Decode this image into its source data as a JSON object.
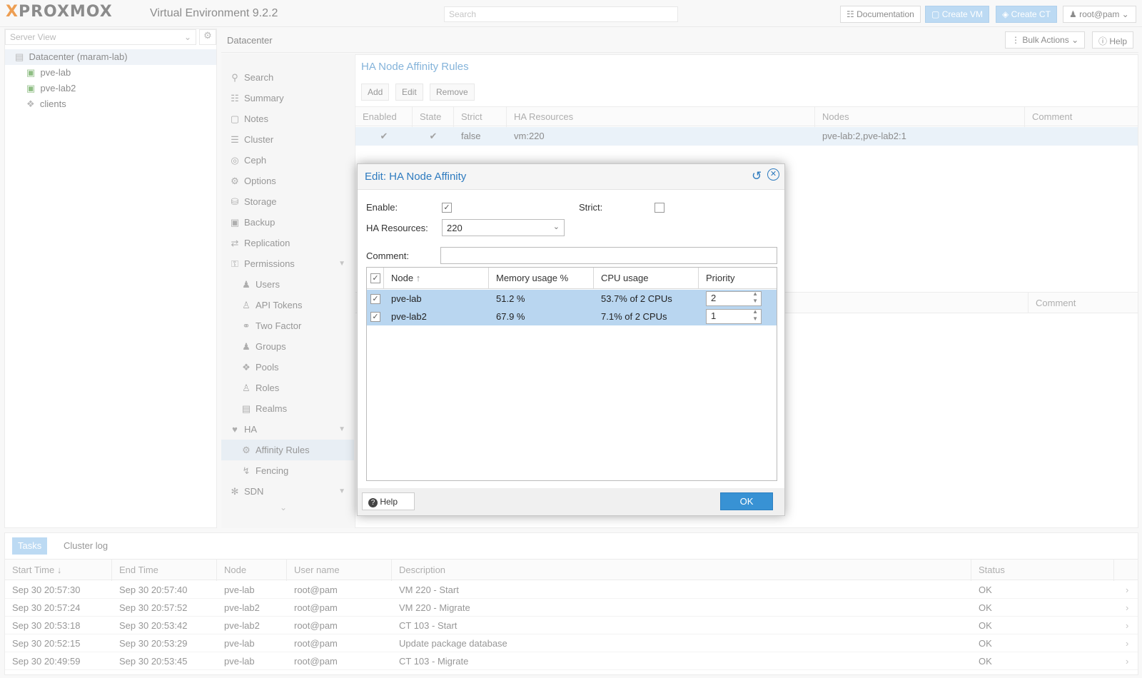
{
  "topbar": {
    "logo_x": "X",
    "logo_rest": "PROXMOX",
    "version": "Virtual Environment 9.2.2",
    "search_placeholder": "Search",
    "documentation": "Documentation",
    "create_vm": "Create VM",
    "create_ct": "Create CT",
    "user": "root@pam"
  },
  "tree": {
    "view": "Server View",
    "items": [
      {
        "label": "Datacenter (maram-lab)",
        "icon": "datacenter-icon"
      },
      {
        "label": "pve-lab",
        "icon": "node-online-icon"
      },
      {
        "label": "pve-lab2",
        "icon": "node-online-icon"
      },
      {
        "label": "clients",
        "icon": "tags-icon"
      }
    ]
  },
  "header": {
    "breadcrumb": "Datacenter",
    "bulk_actions": "Bulk Actions",
    "help": "Help"
  },
  "nav": {
    "items": [
      {
        "label": "Search",
        "icon": "search-icon"
      },
      {
        "label": "Summary",
        "icon": "book-icon"
      },
      {
        "label": "Notes",
        "icon": "notes-icon"
      },
      {
        "label": "Cluster",
        "icon": "server-icon"
      },
      {
        "label": "Ceph",
        "icon": "ceph-icon"
      },
      {
        "label": "Options",
        "icon": "gear-icon"
      },
      {
        "label": "Storage",
        "icon": "database-icon"
      },
      {
        "label": "Backup",
        "icon": "floppy-icon"
      },
      {
        "label": "Replication",
        "icon": "retweet-icon"
      },
      {
        "label": "Permissions",
        "icon": "unlock-icon"
      },
      {
        "label": "Users",
        "icon": "user-icon"
      },
      {
        "label": "API Tokens",
        "icon": "user-outline-icon"
      },
      {
        "label": "Two Factor",
        "icon": "key-icon"
      },
      {
        "label": "Groups",
        "icon": "users-icon"
      },
      {
        "label": "Pools",
        "icon": "tags-icon"
      },
      {
        "label": "Roles",
        "icon": "male-icon"
      },
      {
        "label": "Realms",
        "icon": "address-book-icon"
      },
      {
        "label": "HA",
        "icon": "heartbeat-icon"
      },
      {
        "label": "Affinity Rules",
        "icon": "gears-icon"
      },
      {
        "label": "Fencing",
        "icon": "bolt-icon"
      },
      {
        "label": "SDN",
        "icon": "sdn-icon"
      }
    ]
  },
  "panel": {
    "title": "HA Node Affinity Rules",
    "buttons": {
      "add": "Add",
      "edit": "Edit",
      "remove": "Remove"
    },
    "columns": [
      "Enabled",
      "State",
      "Strict",
      "HA Resources",
      "Nodes",
      "Comment"
    ],
    "row": {
      "enabled": "✔",
      "state": "✔",
      "strict": "false",
      "resources": "vm:220",
      "nodes": "pve-lab:2,pve-lab2:1",
      "comment": ""
    },
    "comment_col2": "Comment"
  },
  "dialog": {
    "title": "Edit: HA Node Affinity",
    "enable_label": "Enable:",
    "enable_checked": true,
    "strict_label": "Strict:",
    "strict_checked": false,
    "resources_label": "HA Resources:",
    "resources_value": "220",
    "comment_label": "Comment:",
    "comment_value": "",
    "grid": {
      "columns": [
        "Node",
        "Memory usage %",
        "CPU usage",
        "Priority"
      ],
      "rows": [
        {
          "node": "pve-lab",
          "memory": "51.2 %",
          "cpu": "53.7% of 2 CPUs",
          "priority": "2"
        },
        {
          "node": "pve-lab2",
          "memory": "67.9 %",
          "cpu": "7.1% of 2 CPUs",
          "priority": "1"
        }
      ]
    },
    "help": "Help",
    "ok": "OK"
  },
  "tasks": {
    "tabs": [
      "Tasks",
      "Cluster log"
    ],
    "columns": [
      "Start Time",
      "End Time",
      "Node",
      "User name",
      "Description",
      "Status"
    ],
    "rows": [
      [
        "Sep 30 20:57:30",
        "Sep 30 20:57:40",
        "pve-lab",
        "root@pam",
        "VM 220 - Start",
        "OK"
      ],
      [
        "Sep 30 20:57:24",
        "Sep 30 20:57:52",
        "pve-lab2",
        "root@pam",
        "VM 220 - Migrate",
        "OK"
      ],
      [
        "Sep 30 20:53:18",
        "Sep 30 20:53:42",
        "pve-lab2",
        "root@pam",
        "CT 103 - Start",
        "OK"
      ],
      [
        "Sep 30 20:52:15",
        "Sep 30 20:53:29",
        "pve-lab",
        "root@pam",
        "Update package database",
        "OK"
      ],
      [
        "Sep 30 20:49:59",
        "Sep 30 20:53:45",
        "pve-lab",
        "root@pam",
        "CT 103 - Migrate",
        "OK"
      ]
    ]
  }
}
